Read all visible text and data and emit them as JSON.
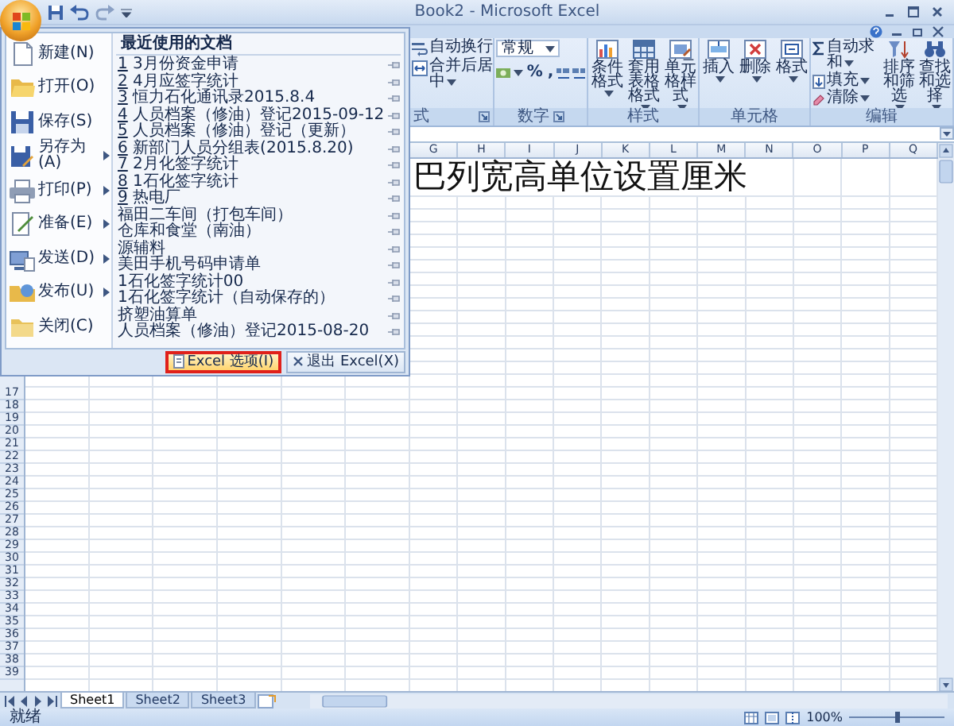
{
  "title_bar": {
    "title": "Book2 - Microsoft Excel"
  },
  "ribbon": {
    "groups": [
      {
        "label": "式",
        "kind": "small",
        "launcher": true,
        "buttons": [
          {
            "label": "自动换行",
            "kind": "wrap",
            "dropdown": false
          },
          {
            "label": "合并后居中",
            "kind": "merge",
            "dropdown": true
          }
        ]
      },
      {
        "label": "数字",
        "kind": "number",
        "launcher": true,
        "format": "常规",
        "buttons": [
          {
            "kind": "currency",
            "dropdown": true
          },
          {
            "kind": "text",
            "label": "%"
          },
          {
            "kind": "text",
            "label": ","
          },
          {
            "kind": "inc_decimal"
          },
          {
            "kind": "dec_decimal"
          }
        ]
      },
      {
        "label": "样式",
        "kind": "large",
        "launcher": false,
        "buttons": [
          {
            "label": "条件格式",
            "kind": "conditional",
            "dropdown": true
          },
          {
            "label": "套用表格格式",
            "kind": "table",
            "dropdown": true
          },
          {
            "label": "单元格样式",
            "kind": "cellstyle",
            "dropdown": true
          }
        ]
      },
      {
        "label": "单元格",
        "kind": "large",
        "launcher": false,
        "buttons": [
          {
            "label": "插入",
            "kind": "insert",
            "dropdown": true
          },
          {
            "label": "删除",
            "kind": "delete",
            "dropdown": true
          },
          {
            "label": "格式",
            "kind": "format",
            "dropdown": true
          }
        ]
      },
      {
        "label": "编辑",
        "kind": "editing",
        "launcher": false,
        "small": [
          {
            "label": "自动求和",
            "kind": "sum",
            "dropdown": true
          },
          {
            "label": "填充",
            "kind": "fill",
            "dropdown": true
          },
          {
            "label": "清除",
            "kind": "clear",
            "dropdown": true
          }
        ],
        "buttons": [
          {
            "label": "排序和筛选",
            "kind": "sort",
            "dropdown": true
          },
          {
            "label": "查找和选择",
            "kind": "find",
            "dropdown": true
          }
        ]
      }
    ]
  },
  "sheet": {
    "columns": [
      "G",
      "H",
      "I",
      "J",
      "K",
      "L",
      "M",
      "N",
      "O",
      "P",
      "Q"
    ],
    "row_numbers": [
      "17",
      "18",
      "19",
      "20",
      "21",
      "22",
      "23",
      "24",
      "25",
      "26",
      "27",
      "28",
      "29",
      "30",
      "31",
      "32",
      "33",
      "34",
      "35",
      "36",
      "37",
      "38",
      "39"
    ],
    "cell_text": "巴列宽高单位设置厘米"
  },
  "sheet_tabs": [
    {
      "label": "Sheet1",
      "selected": true
    },
    {
      "label": "Sheet2",
      "selected": false
    },
    {
      "label": "Sheet3",
      "selected": false
    }
  ],
  "status_bar": {
    "text": "就绪",
    "zoom": "100%",
    "zoom_slider": {
      "level": 0.5
    }
  },
  "office_menu": {
    "commands": [
      {
        "label": "新建(N)",
        "kind": "new",
        "submenu": false
      },
      {
        "label": "打开(O)",
        "kind": "open",
        "submenu": false
      },
      {
        "label": "保存(S)",
        "kind": "save",
        "submenu": false
      },
      {
        "label": "另存为(A)",
        "kind": "saveas",
        "submenu": true
      },
      {
        "label": "打印(P)",
        "kind": "print",
        "submenu": true
      },
      {
        "label": "准备(E)",
        "kind": "prepare",
        "submenu": true
      },
      {
        "label": "发送(D)",
        "kind": "send",
        "submenu": true
      },
      {
        "label": "发布(U)",
        "kind": "publish",
        "submenu": true
      },
      {
        "label": "关闭(C)",
        "kind": "close",
        "submenu": false
      }
    ],
    "recent": {
      "title": "最近使用的文档",
      "items": [
        {
          "number": "1",
          "name": "3月份资金申请"
        },
        {
          "number": "2",
          "name": "4月应签字统计"
        },
        {
          "number": "3",
          "name": "恒力石化通讯录2015.8.4"
        },
        {
          "number": "4",
          "name": "人员档案（修油）登记2015-09-12"
        },
        {
          "number": "5",
          "name": "人员档案（修油）登记（更新）"
        },
        {
          "number": "6",
          "name": "新部门人员分组表(2015.8.20)"
        },
        {
          "number": "7",
          "name": "2月化签字统计"
        },
        {
          "number": "8",
          "name": "1石化签字统计"
        },
        {
          "number": "9",
          "name": "热电厂"
        },
        {
          "name": "福田二车间（打包车间）"
        },
        {
          "name": "仓库和食堂（南油）"
        },
        {
          "name": "源辅料"
        },
        {
          "name": "美田手机号码申请单"
        },
        {
          "name": "1石化签字统计00"
        },
        {
          "name": "1石化签字统计（自动保存的）"
        },
        {
          "name": "挤塑油算单"
        },
        {
          "name": "人员档案（修油）登记2015-08-20"
        }
      ]
    },
    "buttons": [
      {
        "label": "Excel 选项(I)",
        "kind": "options",
        "highlighted": true
      },
      {
        "label": "退出 Excel(X)",
        "kind": "exit",
        "highlighted": false
      }
    ]
  }
}
